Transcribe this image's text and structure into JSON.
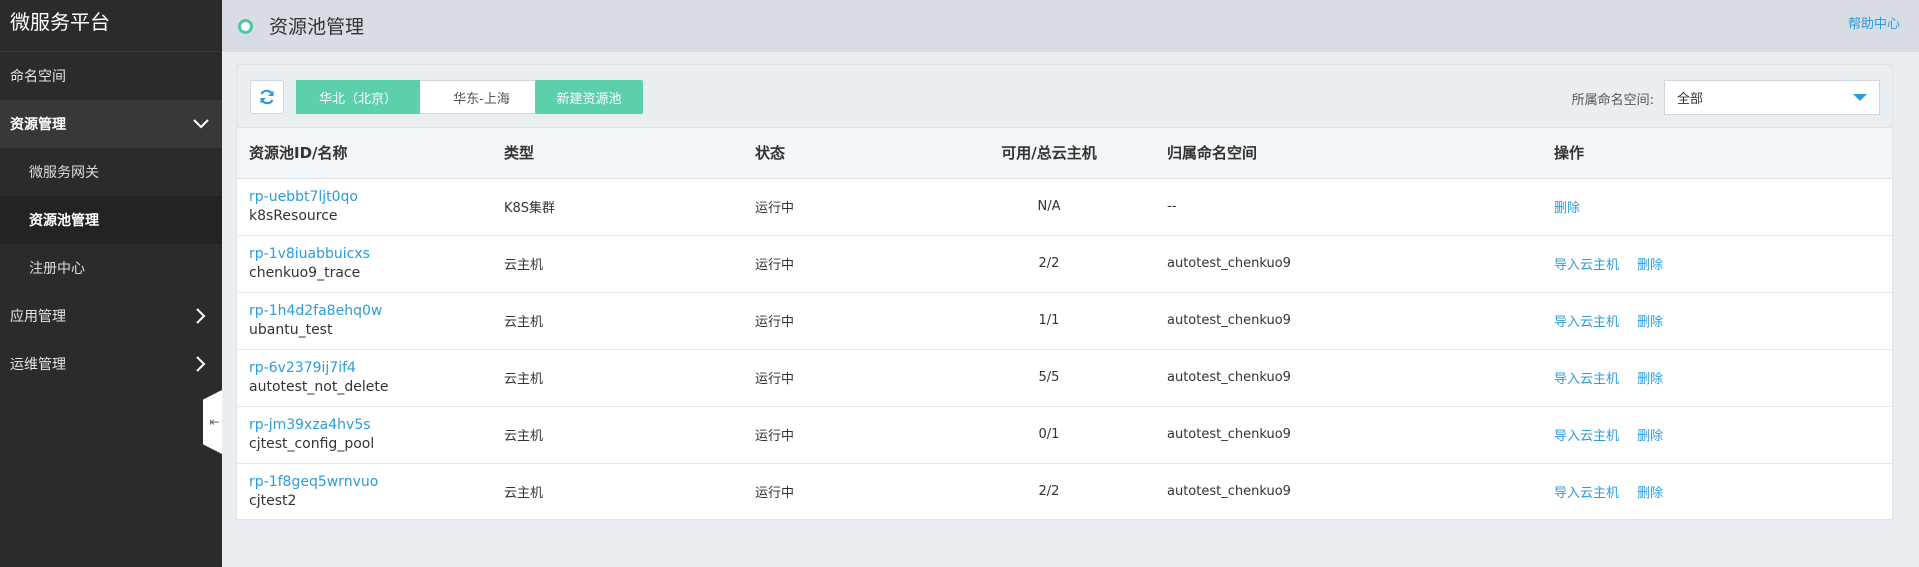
{
  "sidebar": {
    "brand": "微服务平台",
    "items": [
      {
        "label": "命名空间"
      },
      {
        "label": "资源管理"
      },
      {
        "label": "应用管理"
      },
      {
        "label": "运维管理"
      }
    ],
    "sub_items": [
      {
        "label": "微服务网关"
      },
      {
        "label": "资源池管理"
      },
      {
        "label": "注册中心"
      }
    ]
  },
  "header": {
    "title": "资源池管理",
    "help_label": "帮助中心"
  },
  "toolbar": {
    "regions": [
      "华北（北京）",
      "华东-上海"
    ],
    "new_pool_label": "新建资源池",
    "namespace_label": "所属命名空间:",
    "namespace_value": "全部"
  },
  "table": {
    "columns": [
      "资源池ID/名称",
      "类型",
      "状态",
      "可用/总云主机",
      "归属命名空间",
      "操作"
    ],
    "rows": [
      {
        "id": "rp-uebbt7ljt0qo",
        "name": "k8sResource",
        "type": "K8S集群",
        "status": "运行中",
        "hosts": "N/A",
        "namespace": "--",
        "ops": [
          "删除"
        ]
      },
      {
        "id": "rp-1v8iuabbuicxs",
        "name": "chenkuo9_trace",
        "type": "云主机",
        "status": "运行中",
        "hosts": "2/2",
        "namespace": "autotest_chenkuo9",
        "ops": [
          "导入云主机",
          "删除"
        ]
      },
      {
        "id": "rp-1h4d2fa8ehq0w",
        "name": "ubantu_test",
        "type": "云主机",
        "status": "运行中",
        "hosts": "1/1",
        "namespace": "autotest_chenkuo9",
        "ops": [
          "导入云主机",
          "删除"
        ]
      },
      {
        "id": "rp-6v2379ij7if4",
        "name": "autotest_not_delete",
        "type": "云主机",
        "status": "运行中",
        "hosts": "5/5",
        "namespace": "autotest_chenkuo9",
        "ops": [
          "导入云主机",
          "删除"
        ]
      },
      {
        "id": "rp-jm39xza4hv5s",
        "name": "cjtest_config_pool",
        "type": "云主机",
        "status": "运行中",
        "hosts": "0/1",
        "namespace": "autotest_chenkuo9",
        "ops": [
          "导入云主机",
          "删除"
        ]
      },
      {
        "id": "rp-1f8geq5wrnvuo",
        "name": "cjtest2",
        "type": "云主机",
        "status": "运行中",
        "hosts": "2/2",
        "namespace": "autotest_chenkuo9",
        "ops": [
          "导入云主机",
          "删除"
        ]
      }
    ]
  },
  "icons": {
    "refresh": "refresh-icon",
    "collapse": "collapse-sidebar-icon"
  },
  "colors": {
    "accent": "#5ccfad",
    "link": "#2b9cdc",
    "sidebar": "#2b2b2b"
  }
}
